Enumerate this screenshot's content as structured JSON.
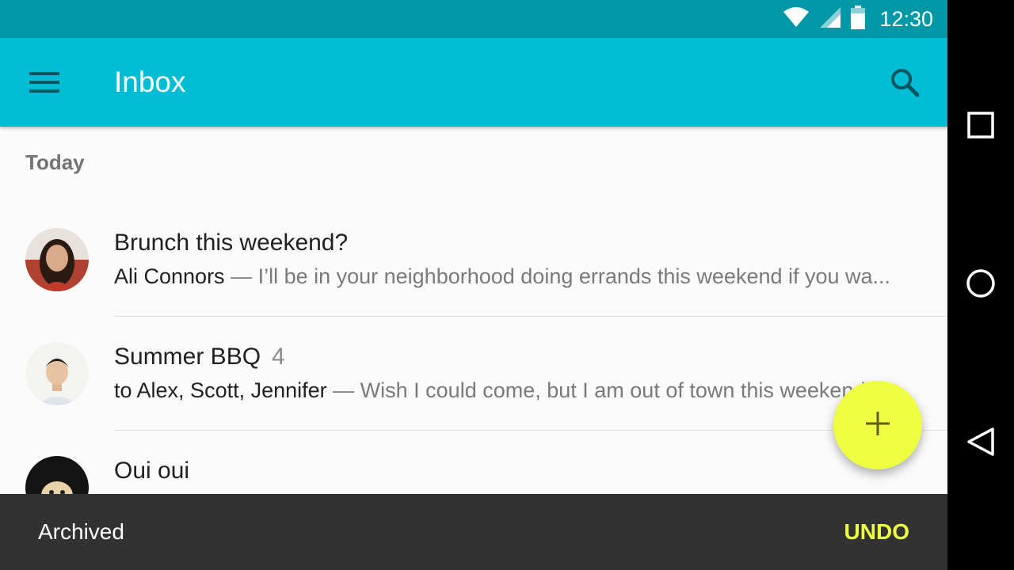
{
  "status_bar": {
    "time": "12:30",
    "icons": [
      "wifi-icon",
      "cellular-signal-icon",
      "battery-icon"
    ]
  },
  "app_bar": {
    "menu_icon": "menu-icon",
    "title": "Inbox",
    "search_icon": "search-icon"
  },
  "subheader": "Today",
  "messages": [
    {
      "title": "Brunch this weekend?",
      "count": "",
      "sender": "Ali Connors",
      "snippet": " — I’ll be in your neighborhood doing errands this weekend if you wa..."
    },
    {
      "title": "Summer BBQ",
      "count": "4",
      "sender": "to Alex, Scott, Jennifer",
      "snippet": " — Wish I could come, but I am out of town this weekend."
    },
    {
      "title": "Oui oui",
      "count": "",
      "sender": "",
      "snippet": ""
    }
  ],
  "fab": {
    "icon": "add-icon",
    "label": "+"
  },
  "snackbar": {
    "text": "Archived",
    "action": "UNDO"
  },
  "nav_bar": {
    "icons": [
      "recents-icon",
      "home-icon",
      "back-icon"
    ]
  },
  "colors": {
    "primary": "#00bcd4",
    "primary_dark": "#0097a7",
    "accent": "#eeff41",
    "snackbar": "#323232"
  }
}
